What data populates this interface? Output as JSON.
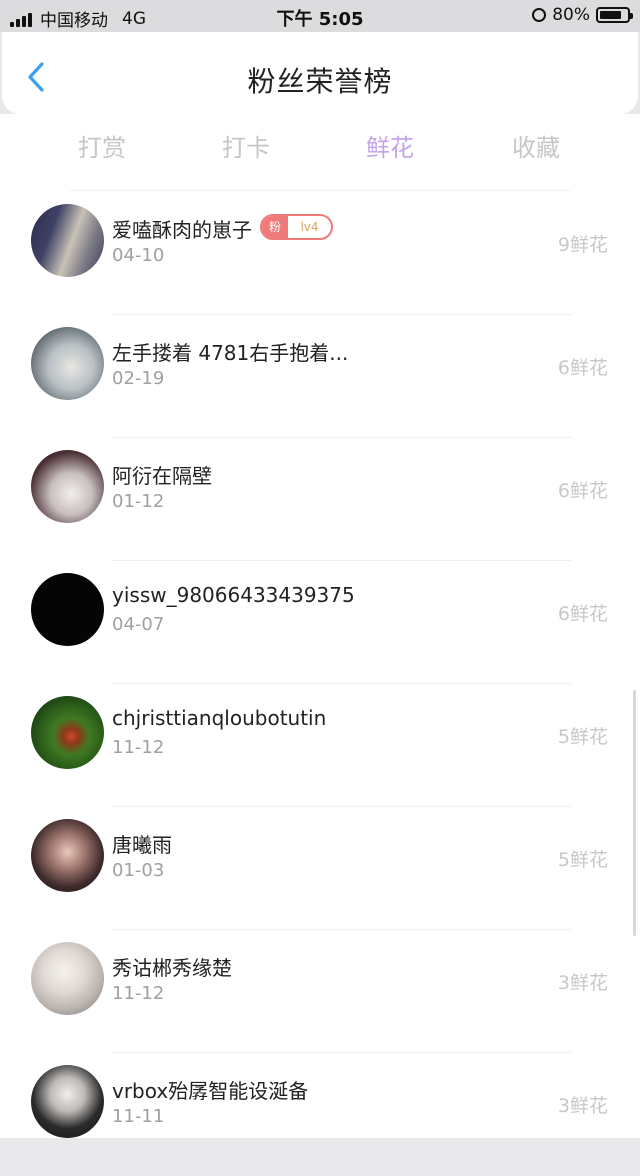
{
  "status_bar": {
    "carrier": "中国移动",
    "network": "4G",
    "time": "下午 5:05",
    "battery": "80%",
    "battery_level": 0.8,
    "icons": [
      "signal-icon",
      "alarm-icon",
      "battery-icon"
    ]
  },
  "header": {
    "title": "粉丝荣誉榜",
    "back_icon": "chevron-left-icon",
    "accent_color": "#3b9ff0"
  },
  "tabs": [
    {
      "label": "打赏",
      "active": false
    },
    {
      "label": "打卡",
      "active": false
    },
    {
      "label": "鲜花",
      "active": true
    },
    {
      "label": "收藏",
      "active": false
    }
  ],
  "active_tab_color": "#c4a3e8",
  "fans": [
    {
      "name": "爱嗑酥肉的崽子",
      "date": "04-10",
      "count": "9鲜花",
      "badge": {
        "label": "粉",
        "level": "lv4"
      }
    },
    {
      "name": "左手搂着 4781右手抱着...",
      "date": "02-19",
      "count": "6鲜花"
    },
    {
      "name": "阿衍在隔壁",
      "date": "01-12",
      "count": "6鲜花"
    },
    {
      "name": "yissw_98066433439375",
      "date": "04-07",
      "count": "6鲜花"
    },
    {
      "name": "chjristtianqloubotutin",
      "date": "11-12",
      "count": "5鲜花"
    },
    {
      "name": "唐曦雨",
      "date": "01-03",
      "count": "5鲜花"
    },
    {
      "name": "秀诂郴秀缘楚",
      "date": "11-12",
      "count": "3鲜花"
    },
    {
      "name": "vrbox殆孱智能设涎备",
      "date": "11-11",
      "count": "3鲜花"
    }
  ]
}
